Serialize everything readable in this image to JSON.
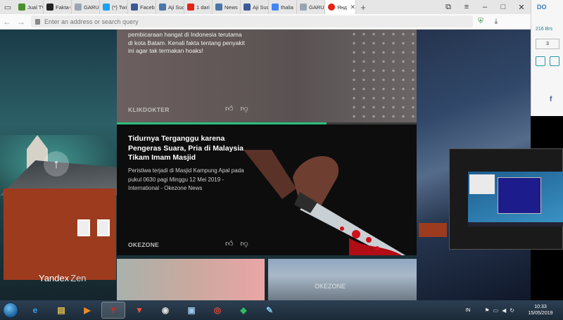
{
  "browser": {
    "tabs": [
      {
        "title": "Jual TV",
        "favicon": "store-icon",
        "color": "#4a8f2b"
      },
      {
        "title": "Fakta-H",
        "favicon": "x-logo-icon",
        "color": "#222222"
      },
      {
        "title": "GARUD",
        "favicon": "page-icon",
        "color": "#9aa5b1"
      },
      {
        "title": "(*) Twi",
        "favicon": "twitter-icon",
        "color": "#1da1f2"
      },
      {
        "title": "Faceb",
        "favicon": "facebook-icon",
        "color": "#3b5998"
      },
      {
        "title": "Aji Sud",
        "favicon": "vk-icon",
        "color": "#4a76a8"
      },
      {
        "title": "1 dari",
        "favicon": "youtube-icon",
        "color": "#e62117"
      },
      {
        "title": "News",
        "favicon": "vk-icon",
        "color": "#4a76a8"
      },
      {
        "title": "Aji Sud",
        "favicon": "facebook-icon",
        "color": "#3b5998"
      },
      {
        "title": "thalia",
        "favicon": "google-icon",
        "color": "#4285f4"
      },
      {
        "title": "GARUD",
        "favicon": "page-icon",
        "color": "#9aa5b1"
      }
    ],
    "active_tab": {
      "title": "Яндек",
      "favicon": "yandex-icon",
      "color": "#e62117"
    },
    "address_placeholder": "Enter an address or search query"
  },
  "feed": {
    "card1": {
      "snippet": "pembicaraan hangat di Indonesia terutama di kota Batam. Kenali fakta tentang penyakit ini agar tak termakan hoaks!",
      "source": "KLIKDOKTER",
      "progress": 0.7
    },
    "card2": {
      "title": "Tidurnya Terganggu karena Pengeras Suara, Pria di Malaysia Tikam Imam Masjid",
      "description": "Peristiwa terjadi di Masjid Kampung Apal pada pukul 0630 pagi Minggu 12 Mei 2019 - International - Okezone News",
      "source": "OKEZONE"
    },
    "card3_watermark": "OKEZONE"
  },
  "zen": {
    "brand": "Yandex",
    "suffix": "Zen"
  },
  "right_panel": {
    "brand_fragment": "DO",
    "count": "216 Brs",
    "page_number": "3"
  },
  "taskbar": {
    "items": [
      {
        "name": "ie-icon",
        "glyph": "e",
        "color": "#3aa0e8"
      },
      {
        "name": "folder-icon",
        "glyph": "▤",
        "color": "#e7c14e"
      },
      {
        "name": "media-player-icon",
        "glyph": "▶",
        "color": "#f08a24"
      },
      {
        "name": "yandex-browser-icon",
        "glyph": "Y",
        "color": "#e62117"
      },
      {
        "name": "brave-icon",
        "glyph": "▼",
        "color": "#fb542b"
      },
      {
        "name": "obs-icon",
        "glyph": "◉",
        "color": "#d9d9d9"
      },
      {
        "name": "network-icon",
        "glyph": "▣",
        "color": "#9cc6e8"
      },
      {
        "name": "screen-capture-icon",
        "glyph": "◎",
        "color": "#e94a3a"
      },
      {
        "name": "evernote-icon",
        "glyph": "◆",
        "color": "#2dbe60"
      },
      {
        "name": "paint-icon",
        "glyph": "✎",
        "color": "#7fc4f2"
      }
    ],
    "language": "IN",
    "time": "10:33",
    "date": "15/05/2019"
  }
}
